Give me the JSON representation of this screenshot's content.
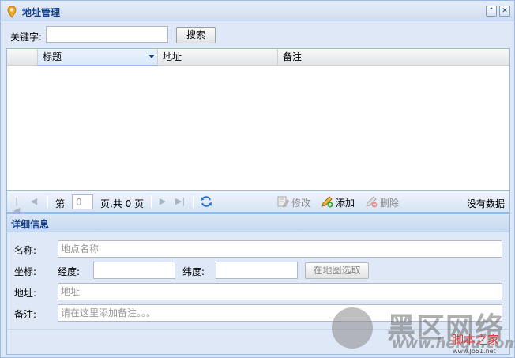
{
  "window": {
    "title": "地址管理"
  },
  "search": {
    "keyword_label": "关键字:",
    "keyword_value": "",
    "button_label": "搜索"
  },
  "grid": {
    "columns": [
      {
        "label": "标题"
      },
      {
        "label": "地址"
      },
      {
        "label": "备注"
      }
    ],
    "rows": []
  },
  "pager": {
    "page_prefix": "第",
    "page_value": "0",
    "page_suffix": "页,共 0 页",
    "actions": {
      "edit": "修改",
      "add": "添加",
      "delete": "删除"
    },
    "status": "没有数据"
  },
  "detail": {
    "title": "详细信息",
    "name_label": "名称:",
    "name_placeholder": "地点名称",
    "coord_label": "坐标:",
    "lng_label": "经度:",
    "lat_label": "纬度:",
    "map_button": "在地图选取",
    "address_label": "地址:",
    "address_placeholder": "地址",
    "remark_label": "备注:",
    "remark_placeholder": "请在这里添加备注。。。"
  },
  "watermark": {
    "cn": "黑区网络",
    "url": "www.heiqu.com",
    "brand": "脚本之家",
    "site": "www.Jb51.net"
  },
  "colors": {
    "title": "#15428b",
    "border": "#99bbe8",
    "background": "#dfe8f6"
  }
}
